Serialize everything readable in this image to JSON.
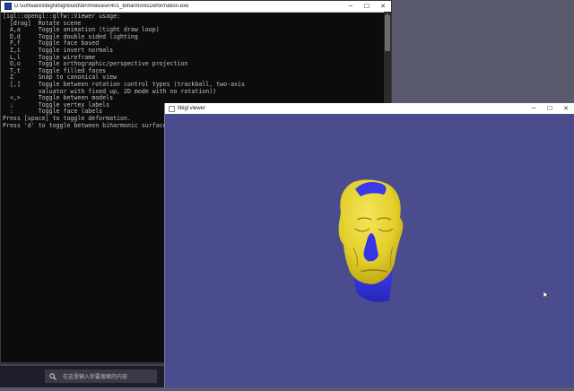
{
  "console": {
    "title": "D:\\software\\libigl\\libigl\\build\\bin\\Release\\401_BiharmonicDeformation.exe",
    "lines": [
      "[igl::opengl::glfw::Viewer usage:",
      "  [drag]  Rotate scene",
      "  A,a     Toggle animation (tight draw loop)",
      "  D,d     Toggle double sided lighting",
      "  F,f     Toggle face based",
      "  I,i     Toggle invert normals",
      "  L,l     Toggle wireframe",
      "  O,o     Toggle orthographic/perspective projection",
      "  T,t     Toggle filled faces",
      "  Z       Snap to canonical view",
      "  [,]     Toggle between rotation control types (trackball, two-axis",
      "          valuator with fixed up, 2D mode with no rotation))",
      "  <,>     Toggle between models",
      "  ;       Toggle vertex labels",
      "  :       Toggle face labels",
      "Press [space] to toggle deformation.",
      "Press 'd' to toggle between biharmonic surface or displacements."
    ]
  },
  "viewer": {
    "title": "libigl viewer"
  },
  "taskbar": {
    "search_placeholder": "在这里输入你要搜索的内容"
  },
  "window_buttons": {
    "minimize": "─",
    "maximize": "☐",
    "close": "✕"
  },
  "colors": {
    "viewer_background": "#4b4c8d",
    "mesh_yellow": "#e6d330",
    "mesh_blue": "#3434e0",
    "console_background": "#0c0c0c"
  }
}
